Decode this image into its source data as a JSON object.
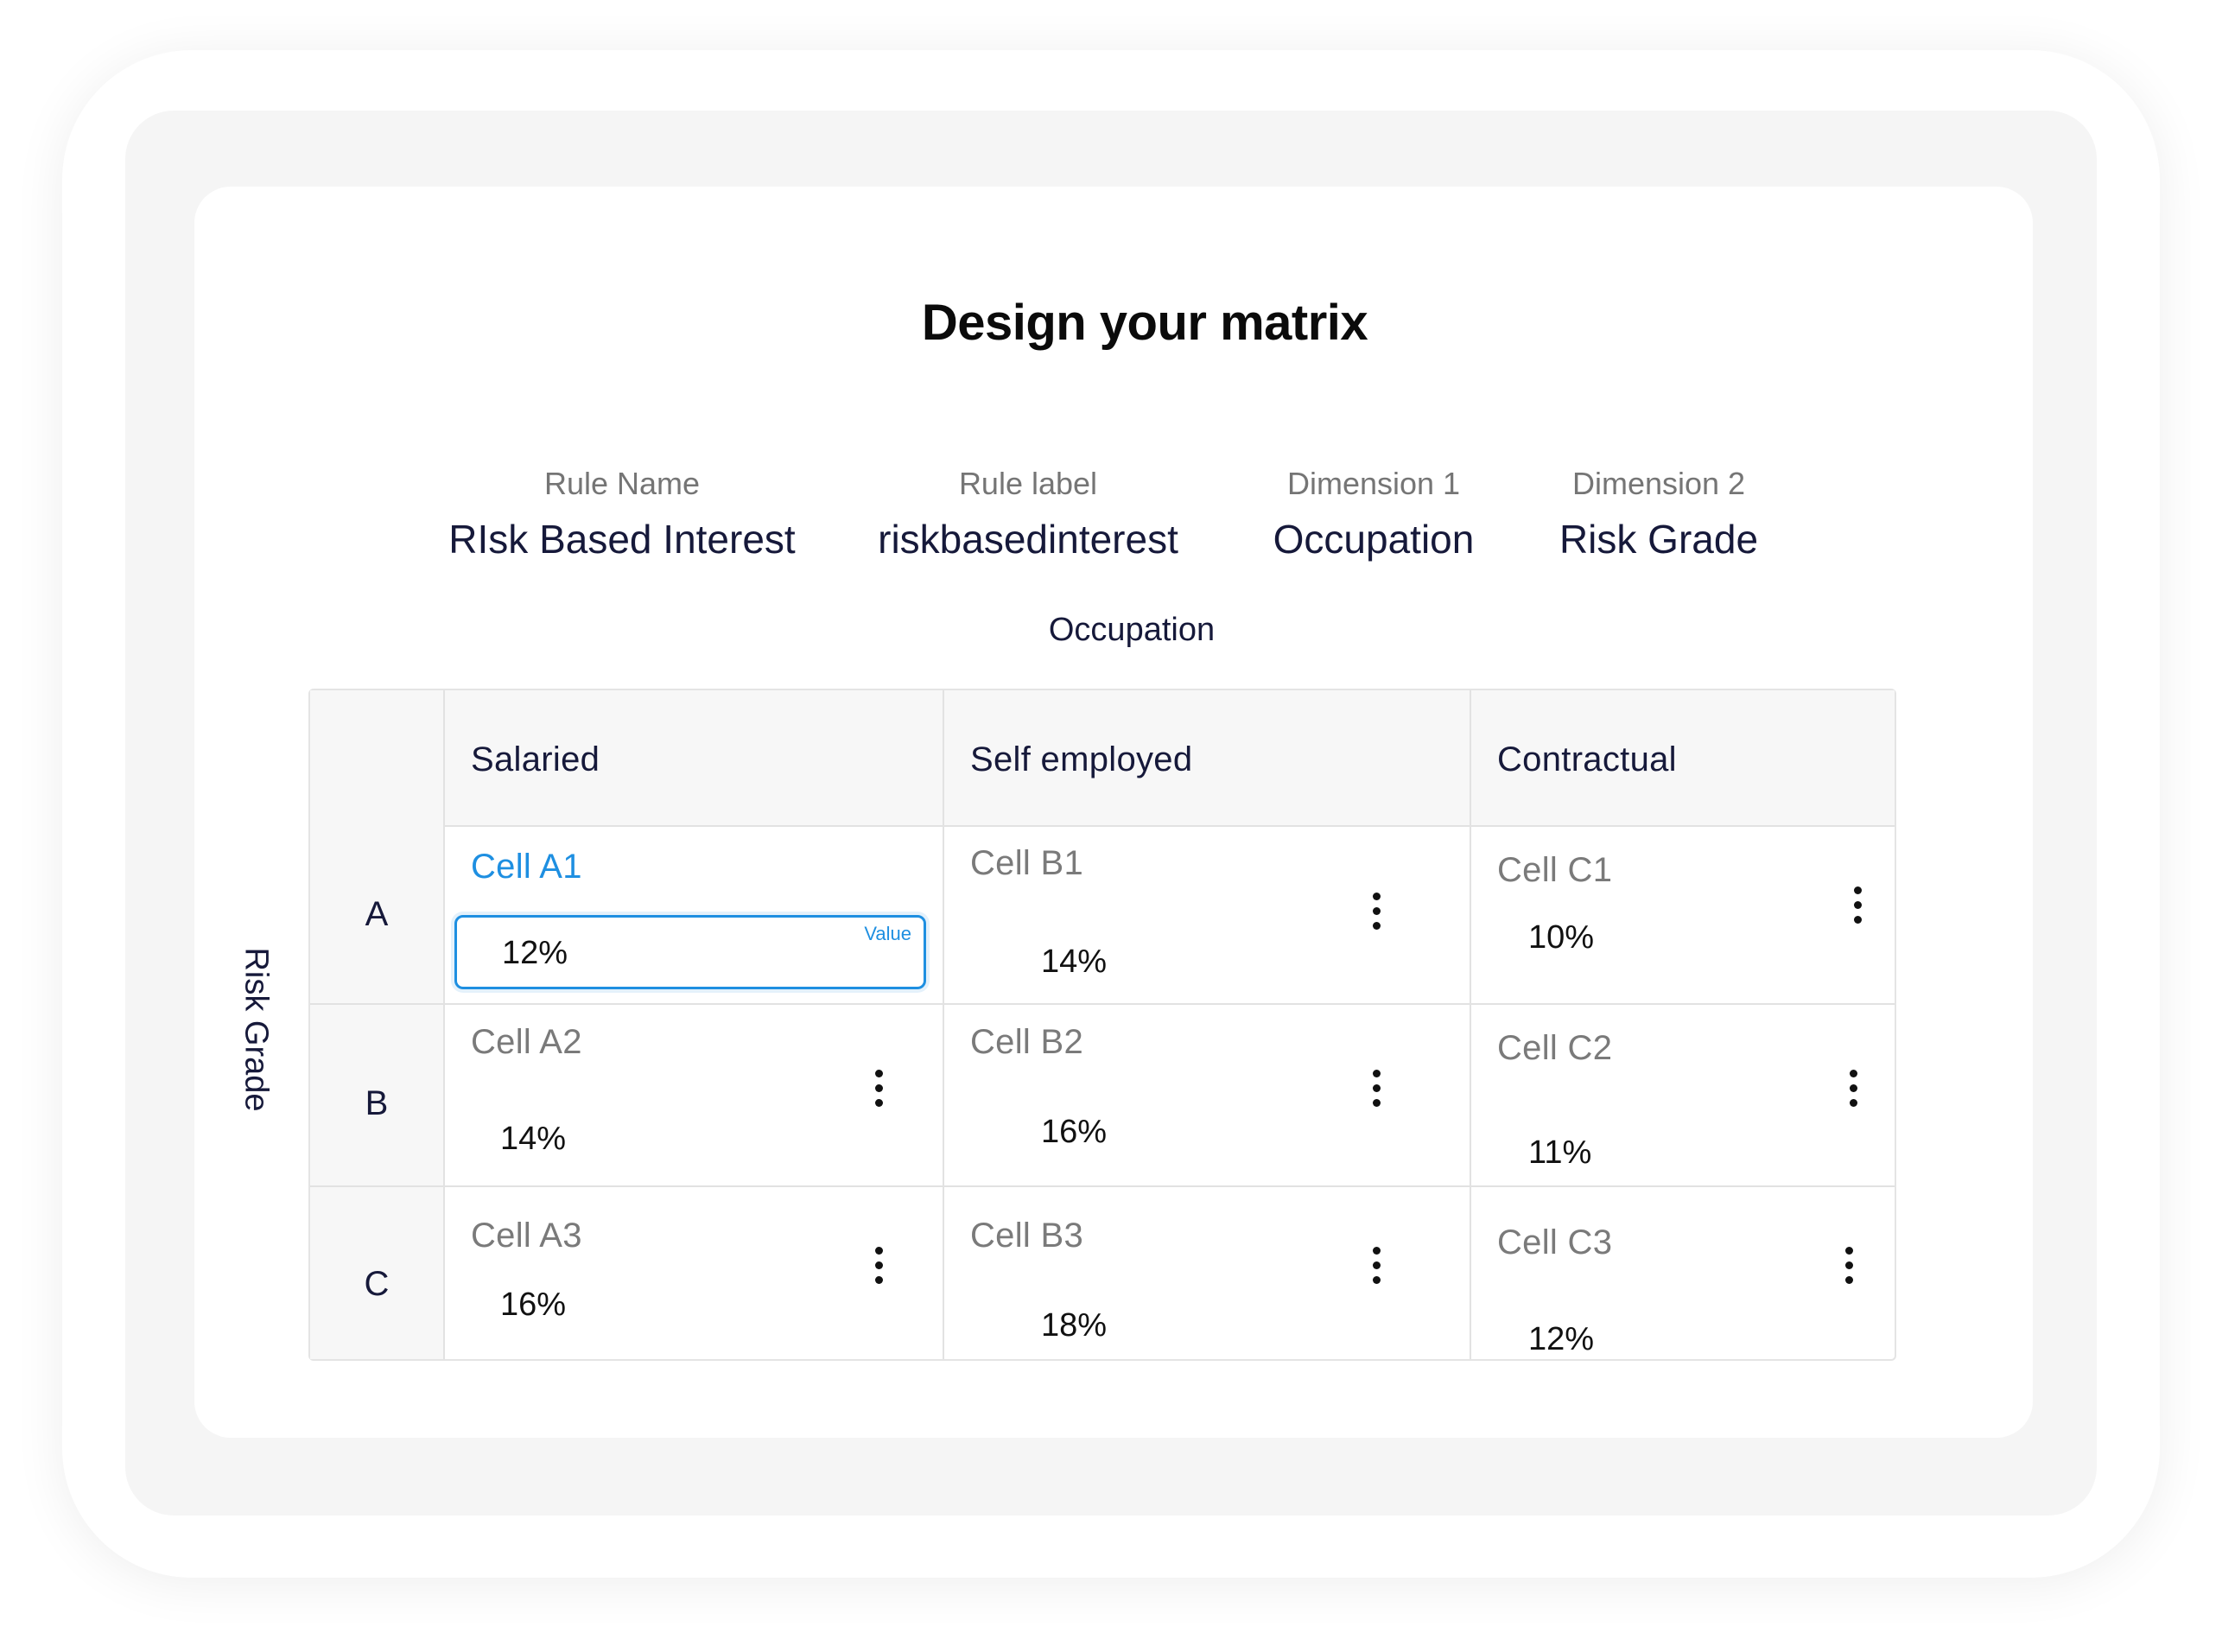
{
  "title": "Design your matrix",
  "meta": {
    "rule_name": {
      "label": "Rule Name",
      "value": "RIsk Based Interest"
    },
    "rule_label": {
      "label": "Rule label",
      "value": "riskbasedinterest"
    },
    "dimension_1": {
      "label": "Dimension 1",
      "value": "Occupation"
    },
    "dimension_2": {
      "label": "Dimension 2",
      "value": "Risk Grade"
    }
  },
  "axis": {
    "columns_title": "Occupation",
    "rows_title": "Risk Grade"
  },
  "columns": [
    "Salaried",
    "Self employed",
    "Contractual"
  ],
  "rows": [
    {
      "label": "A",
      "cells": [
        {
          "name": "Cell A1",
          "value": "12%",
          "active": true,
          "field_label": "Value"
        },
        {
          "name": "Cell B1",
          "value": "14%"
        },
        {
          "name": "Cell C1",
          "value": "10%"
        }
      ]
    },
    {
      "label": "B",
      "cells": [
        {
          "name": "Cell A2",
          "value": "14%"
        },
        {
          "name": "Cell B2",
          "value": "16%"
        },
        {
          "name": "Cell C2",
          "value": "11%"
        }
      ]
    },
    {
      "label": "C",
      "cells": [
        {
          "name": "Cell A3",
          "value": "16%"
        },
        {
          "name": "Cell B3",
          "value": "18%"
        },
        {
          "name": "Cell C3",
          "value": "12%"
        }
      ]
    }
  ],
  "colors": {
    "accent": "#1e8fe1",
    "text_dark": "#16193a",
    "text_muted": "#7a7a7a"
  },
  "icons": {
    "cell_menu": "kebab-menu-icon"
  }
}
